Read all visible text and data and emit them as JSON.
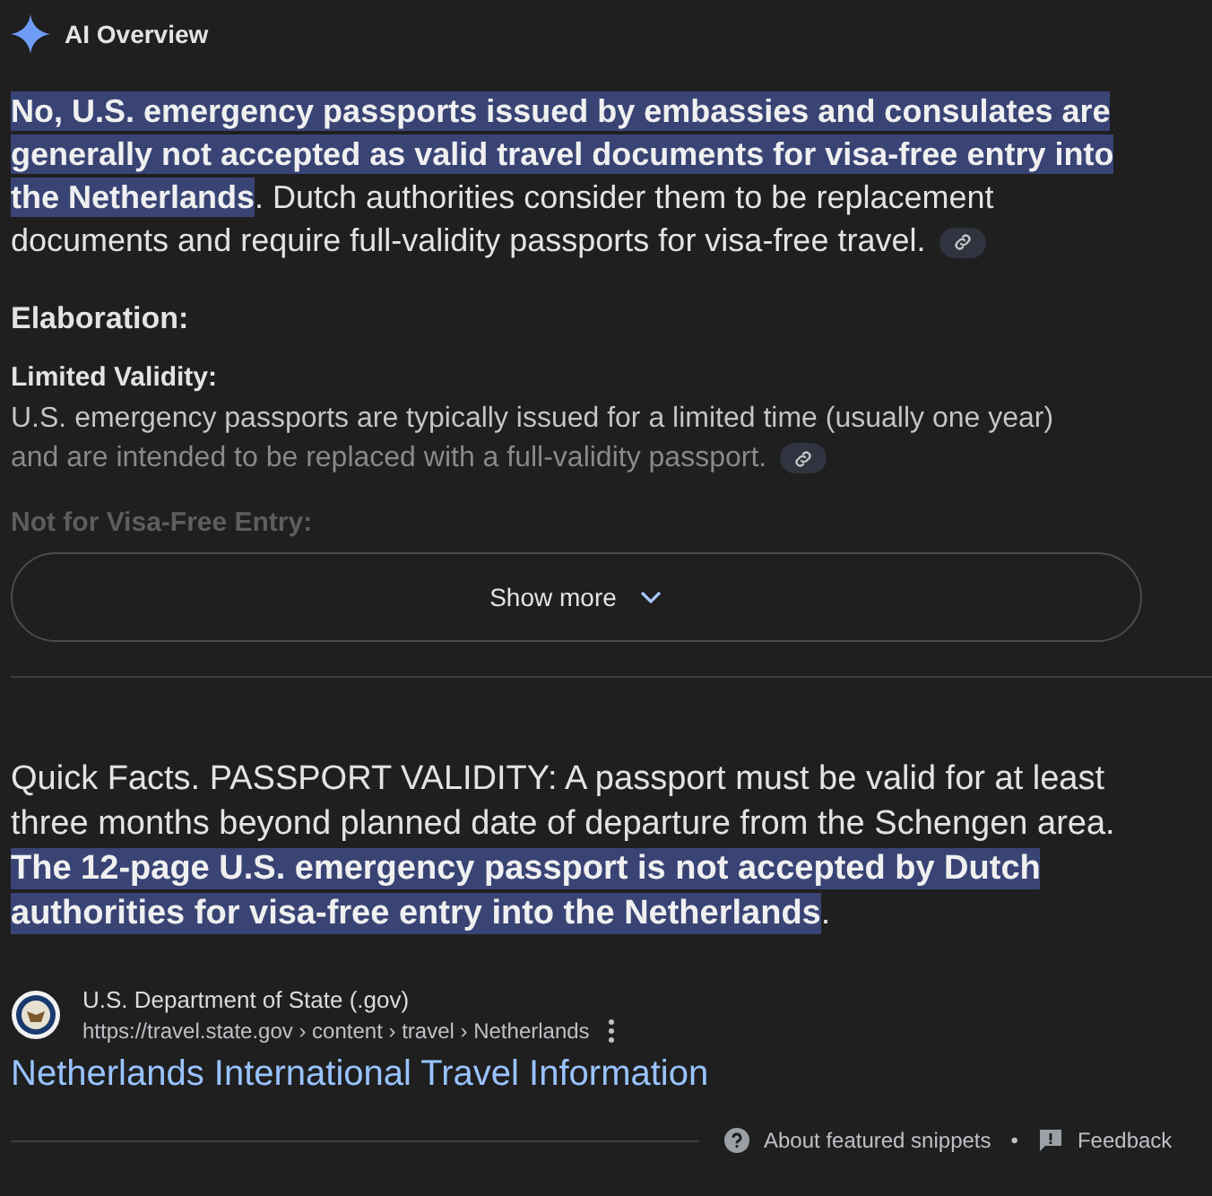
{
  "header": {
    "title": "AI Overview"
  },
  "summary": "**No, U.S. emergency passports issued by embassies and consulates are generally not accepted as valid travel documents for visa-free entry into the Netherlands**. Dutch authorities consider them to be replacement documents and require full-validity passports for visa-free travel.",
  "elaboration": {
    "heading": "Elaboration:",
    "points": [
      {
        "title": "Limited Validity:",
        "text": "U.S. emergency passports are typically issued for a limited time (usually one year) and are intended to be replaced with a full-validity passport.",
        "faded": false
      },
      {
        "title": "Not for Visa-Free Entry:",
        "faded": true
      }
    ]
  },
  "show_more": "Show more",
  "snippet": "Quick Facts. PASSPORT VALIDITY: A passport must be valid for at least three months beyond planned date of departure from the Schengen area. **The 12-page U.S. emergency passport is not accepted by Dutch authorities for visa-free entry into the Netherlands**.",
  "source": {
    "site": "U.S. Department of State (.gov)",
    "url": "https://travel.state.gov › content › travel › Netherlands",
    "title": "Netherlands International Travel Information"
  },
  "footer": {
    "about": "About featured snippets",
    "separator": "•",
    "feedback": "Feedback"
  }
}
